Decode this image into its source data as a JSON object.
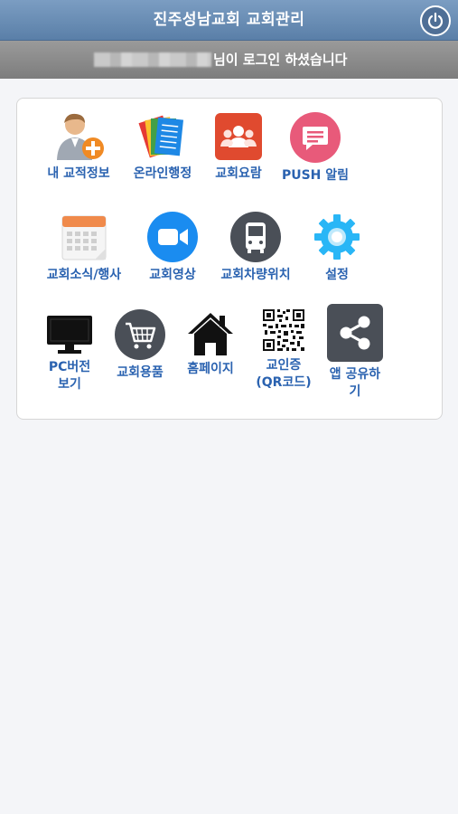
{
  "header": {
    "title": "진주성남교회 교회관리"
  },
  "login_bar": {
    "message": "님이 로그인 하셨습니다"
  },
  "menu": [
    {
      "label": "내 교적정보",
      "icon": "user-add-icon"
    },
    {
      "label": "온라인행정",
      "icon": "documents-icon"
    },
    {
      "label": "교회요람",
      "icon": "people-group-icon"
    },
    {
      "label": "PUSH 알림",
      "icon": "chat-bubble-icon"
    },
    {
      "label": "교회소식/행사",
      "icon": "calendar-icon"
    },
    {
      "label": "교회영상",
      "icon": "video-camera-icon"
    },
    {
      "label": "교회차량위치",
      "icon": "bus-icon"
    },
    {
      "label": "설정",
      "icon": "gear-icon"
    },
    {
      "label": "PC버전\n보기",
      "icon": "monitor-icon"
    },
    {
      "label": "교회용품",
      "icon": "shopping-cart-icon"
    },
    {
      "label": "홈페이지",
      "icon": "home-icon"
    },
    {
      "label": "교인증\n(QR코드)",
      "icon": "qr-code-icon"
    },
    {
      "label": "앱 공유하\n기",
      "icon": "share-icon"
    }
  ],
  "colors": {
    "header": "#5f84ad",
    "login_bar": "#8a8a8a",
    "label": "#2a62b0"
  }
}
